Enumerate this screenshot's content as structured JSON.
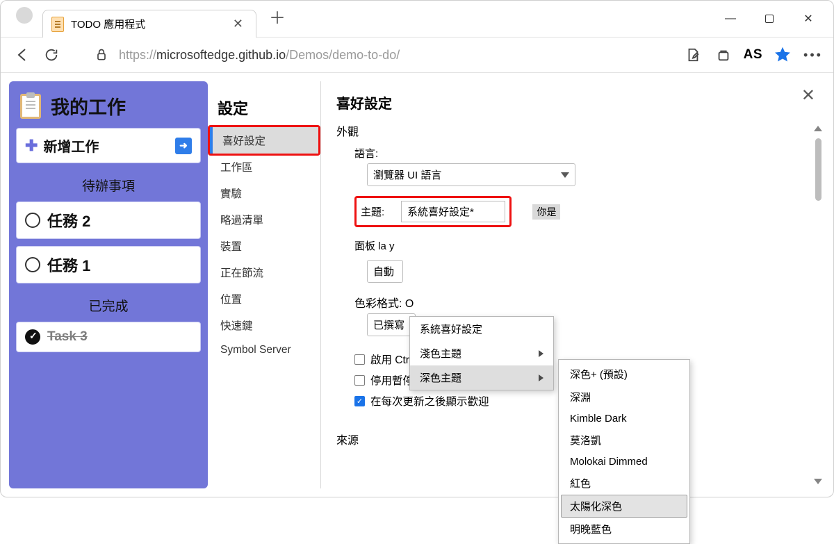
{
  "browser": {
    "tab_title": "TODO 應用程式",
    "url_prefix": "https://",
    "url_host": "microsoftedge.github.io",
    "url_path": "/Demos/demo-to-do/",
    "profile_label": "AS"
  },
  "tasks": {
    "title": "我的工作",
    "add_label": "新增工作",
    "pending_label": "待辦事項",
    "done_label": "已完成",
    "items": [
      {
        "label": "任務 2",
        "done": false
      },
      {
        "label": "任務 1",
        "done": false
      }
    ],
    "done_items": [
      {
        "label": "Task 3"
      }
    ]
  },
  "settings_nav": {
    "title": "設定",
    "items": [
      "喜好設定",
      "工作區",
      "實驗",
      "略過清單",
      "裝置",
      "正在節流",
      "位置",
      "快速鍵",
      "Symbol Server"
    ]
  },
  "panel": {
    "title": "喜好設定",
    "appearance_label": "外觀",
    "language_label": "語言:",
    "language_value": "瀏覽器 UI 語言",
    "theme_label": "主題:",
    "theme_value": "系統喜好設定*",
    "you_are": "你是",
    "panel_layout_label": "面板 la y",
    "panel_layout_value": "自動",
    "color_format_label": "色彩格式: O",
    "color_format_value": "已撰寫",
    "cb_shortcut": "啟用 Ctrl + 1-9 快速鍵以切換",
    "cb_pause": "停用暫停狀態重迭",
    "cb_welcome": "在每次更新之後顯示歡迎",
    "sources_label": "來源"
  },
  "theme_menu": {
    "items": [
      "系統喜好設定",
      "淺色主題",
      "深色主題"
    ]
  },
  "dark_submenu": {
    "items": [
      "深色+ (預設)",
      "深淵",
      "Kimble Dark",
      "莫洛凱",
      "Molokai Dimmed",
      "紅色",
      "太陽化深色",
      "明晚藍色"
    ]
  }
}
